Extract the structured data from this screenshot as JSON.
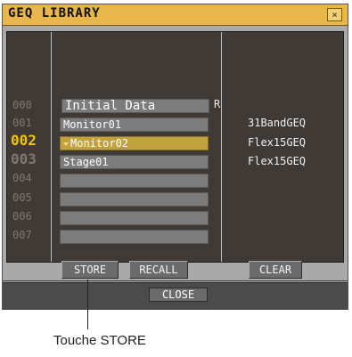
{
  "window": {
    "title": "GEQ LIBRARY",
    "close_glyph": "×"
  },
  "library": {
    "rows": [
      {
        "number": "000",
        "name": "Initial Data",
        "flag": "R",
        "type": ""
      },
      {
        "number": "001",
        "name": "Monitor01",
        "flag": "",
        "type": "31BandGEQ"
      },
      {
        "number": "002",
        "name": "Monitor02",
        "flag": "",
        "type": "Flex15GEQ"
      },
      {
        "number": "003",
        "name": "Stage01",
        "flag": "",
        "type": "Flex15GEQ"
      },
      {
        "number": "004",
        "name": "",
        "flag": "",
        "type": ""
      },
      {
        "number": "005",
        "name": "",
        "flag": "",
        "type": ""
      },
      {
        "number": "006",
        "name": "",
        "flag": "",
        "type": ""
      },
      {
        "number": "007",
        "name": "",
        "flag": "",
        "type": ""
      }
    ],
    "selected_number": "002"
  },
  "buttons": {
    "store": "STORE",
    "recall": "RECALL",
    "clear": "CLEAR",
    "close": "CLOSE"
  },
  "caption": "Touche STORE",
  "colors": {
    "titlebar": "#e8b64a",
    "panel": "#3f3a36",
    "selected": "#c1a23c",
    "current_number": "#f2c30d"
  }
}
